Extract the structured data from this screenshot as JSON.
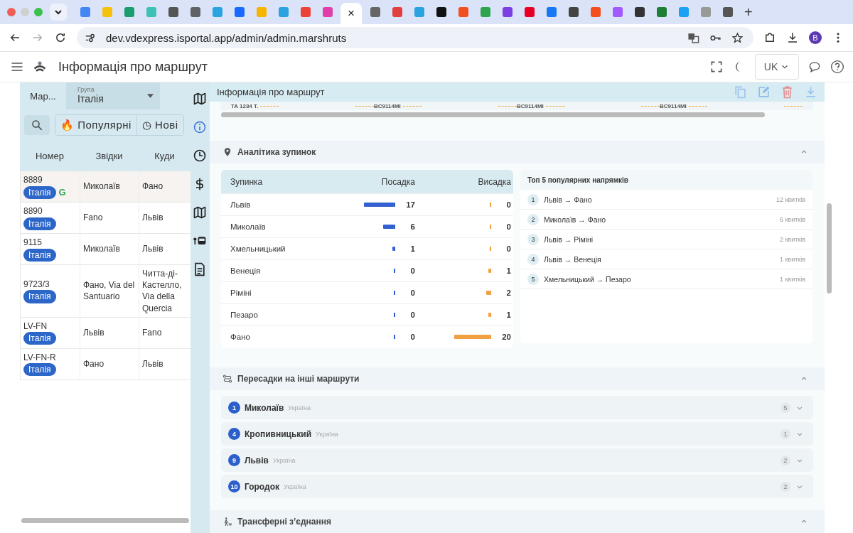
{
  "browser": {
    "close_tab": "×",
    "new_tab": "+",
    "url": "dev.vdexpress.isportal.app/admin/admin.marshruts",
    "profile": "B"
  },
  "header": {
    "title": "Інформація про маршрут",
    "language": "UK"
  },
  "sidebar": {
    "tab_label": "Мар...",
    "group_label": "Група",
    "group_value": "Італія",
    "filters": [
      {
        "icon": "🔥",
        "label": "Популярні",
        "selected": false
      },
      {
        "icon": "◷",
        "label": "Нові",
        "selected": false
      }
    ],
    "columns": [
      "Номер",
      "Звідки",
      "Куди"
    ],
    "rows": [
      {
        "number": "8889",
        "tag": "Італія",
        "mark": "G",
        "from": "Миколаїв",
        "to": "Фано",
        "selected": true
      },
      {
        "number": "8890",
        "tag": "Італія",
        "from": "Fano",
        "to": "Львів",
        "selected": false
      },
      {
        "number": "9115",
        "tag": "Італія",
        "from": "Миколаїв",
        "to": "Львів",
        "selected": false
      },
      {
        "number": "9723/3",
        "tag": "Італія",
        "from": "Фано, Via del Santuario",
        "to": "Читта-ді-Кастелло, Via della Quercia",
        "selected": false
      },
      {
        "number": "LV-FN",
        "tag": "Італія",
        "from": "Львів",
        "to": "Fano",
        "selected": false
      },
      {
        "number": "LV-FN-R",
        "tag": "Італія",
        "from": "Фано",
        "to": "Львів",
        "selected": false
      }
    ]
  },
  "rail": [
    {
      "kind": "map",
      "selected": false
    },
    {
      "kind": "info",
      "selected": true
    },
    {
      "kind": "clock",
      "selected": false
    },
    {
      "kind": "dollar",
      "selected": false
    },
    {
      "kind": "map",
      "selected": false
    },
    {
      "kind": "bus",
      "selected": false
    },
    {
      "kind": "document",
      "selected": false
    }
  ],
  "panel": {
    "title": "Інформація про маршрут",
    "schedule_strip": [
      "TA 1234 T.",
      "BC9114MI",
      "BC9114MI",
      "BC9114MI"
    ],
    "stop_analytics": {
      "title": "Аналітика зупинок",
      "expanded": true,
      "columns": [
        "Зупинка",
        "Посадка",
        "Висадка"
      ],
      "rows": [
        {
          "stop": "Львів",
          "boarding": {
            "value": "17",
            "level": 0.85
          },
          "alighting": {
            "value": "0",
            "level": 0
          }
        },
        {
          "stop": "Миколаїв",
          "boarding": {
            "value": "6",
            "level": 0.3
          },
          "alighting": {
            "value": "0",
            "level": 0
          }
        },
        {
          "stop": "Хмельницький",
          "boarding": {
            "value": "1",
            "level": 0.05
          },
          "alighting": {
            "value": "0",
            "level": 0
          }
        },
        {
          "stop": "Венеція",
          "boarding": {
            "value": "0",
            "level": 0
          },
          "alighting": {
            "value": "1",
            "level": 0.05
          }
        },
        {
          "stop": "Ріміні",
          "boarding": {
            "value": "0",
            "level": 0
          },
          "alighting": {
            "value": "2",
            "level": 0.1
          }
        },
        {
          "stop": "Пезаро",
          "boarding": {
            "value": "0",
            "level": 0
          },
          "alighting": {
            "value": "1",
            "level": 0.05
          }
        },
        {
          "stop": "Фано",
          "boarding": {
            "value": "0",
            "level": 0
          },
          "alighting": {
            "value": "20",
            "level": 1
          }
        }
      ],
      "top_routes": {
        "title": "Топ 5 популярних напрямків",
        "items": [
          {
            "rank": "1",
            "route": "Львів → Фано",
            "tickets": "12 квитків"
          },
          {
            "rank": "2",
            "route": "Миколаїв → Фано",
            "tickets": "6 квитків"
          },
          {
            "rank": "3",
            "route": "Львів → Ріміні",
            "tickets": "2 квитків"
          },
          {
            "rank": "4",
            "route": "Львів → Венеція",
            "tickets": "1 квитків"
          },
          {
            "rank": "5",
            "route": "Хмельницький → Пезаро",
            "tickets": "1 квитків"
          }
        ]
      }
    },
    "transfers": {
      "title": "Пересадки на інші маршрути",
      "expanded": true,
      "items": [
        {
          "number": "1",
          "city": "Миколаїв",
          "country": "Україна",
          "count": "5",
          "expanded": false
        },
        {
          "number": "4",
          "city": "Кропивницький",
          "country": "Україна",
          "count": "1",
          "expanded": false
        },
        {
          "number": "9",
          "city": "Львів",
          "country": "Україна",
          "count": "2",
          "expanded": false
        },
        {
          "number": "10",
          "city": "Городок",
          "country": "Україна",
          "count": "2",
          "expanded": false
        }
      ]
    },
    "transfer_connections": {
      "title": "Трансферні з’єднання",
      "expanded": true
    }
  }
}
